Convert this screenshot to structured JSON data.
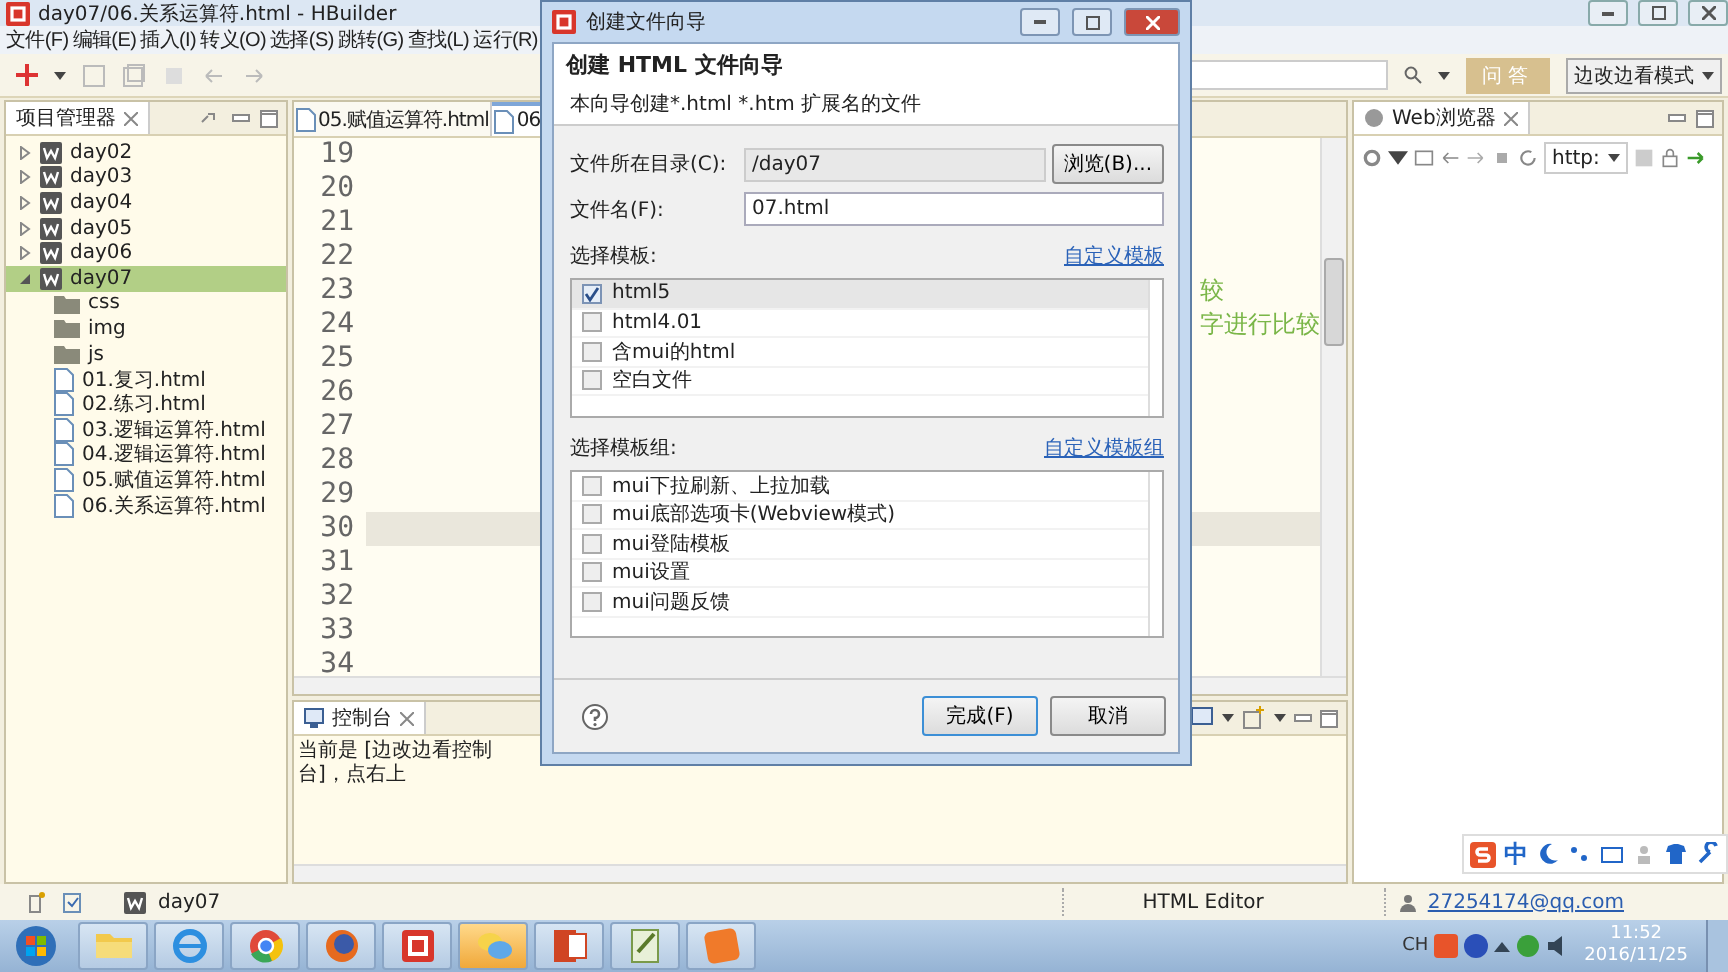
{
  "window": {
    "title": "day07/06.关系运算符.html - HBuilder"
  },
  "menu": [
    "文件(F)",
    "编辑(E)",
    "插入(I)",
    "转义(O)",
    "选择(S)",
    "跳转(G)",
    "查找(L)",
    "运行(R)"
  ],
  "toolbar": {
    "qa_button": "问答",
    "mode_select": "边改边看模式"
  },
  "project_panel": {
    "title": "项目管理器",
    "tree": [
      {
        "label": "day02",
        "kind": "project",
        "expanded": false,
        "selected": false
      },
      {
        "label": "day03",
        "kind": "project",
        "expanded": false,
        "selected": false
      },
      {
        "label": "day04",
        "kind": "project",
        "expanded": false,
        "selected": false
      },
      {
        "label": "day05",
        "kind": "project",
        "expanded": false,
        "selected": false
      },
      {
        "label": "day06",
        "kind": "project",
        "expanded": false,
        "selected": false
      },
      {
        "label": "day07",
        "kind": "project",
        "expanded": true,
        "selected": true,
        "children": [
          {
            "label": "css",
            "kind": "folder",
            "selected": false
          },
          {
            "label": "img",
            "kind": "folder",
            "selected": false
          },
          {
            "label": "js",
            "kind": "folder",
            "selected": false
          },
          {
            "label": "01.复习.html",
            "kind": "file",
            "selected": false
          },
          {
            "label": "02.练习.html",
            "kind": "file",
            "selected": false
          },
          {
            "label": "03.逻辑运算符.html",
            "kind": "file",
            "selected": false
          },
          {
            "label": "04.逻辑运算符.html",
            "kind": "file",
            "selected": false
          },
          {
            "label": "05.赋值运算符.html",
            "kind": "file",
            "selected": false
          },
          {
            "label": "06.关系运算符.html",
            "kind": "file",
            "selected": false
          }
        ]
      }
    ]
  },
  "editor": {
    "tabs": [
      {
        "label": "05.赋值运算符.html",
        "selected": false
      },
      {
        "label": "06",
        "selected": true
      }
    ],
    "lines": [
      {
        "number": "19",
        "current": false
      },
      {
        "number": "20",
        "current": false
      },
      {
        "number": "21",
        "current": false
      },
      {
        "number": "22",
        "current": false
      },
      {
        "number": "23",
        "current": false,
        "text": "较"
      },
      {
        "number": "24",
        "current": false,
        "text": "字进行比较"
      },
      {
        "number": "25",
        "current": false
      },
      {
        "number": "26",
        "current": false
      },
      {
        "number": "27",
        "current": false
      },
      {
        "number": "28",
        "current": false
      },
      {
        "number": "29",
        "current": false
      },
      {
        "number": "30",
        "current": true
      },
      {
        "number": "31",
        "current": false
      },
      {
        "number": "32",
        "current": false
      },
      {
        "number": "33",
        "current": false
      },
      {
        "number": "34",
        "current": false
      }
    ]
  },
  "console": {
    "title": "控制台",
    "message": "当前是 [边改边看控制台]，点右上"
  },
  "browser": {
    "title": "Web浏览器",
    "address": "http:"
  },
  "status_bar": {
    "project": "day07",
    "editor_type": "HTML Editor",
    "account": "27254174@qq.com"
  },
  "ime_bar": {
    "mode": "中"
  },
  "dialog": {
    "title": "创建文件向导",
    "heading": "创建 HTML 文件向导",
    "description": "本向导创建*.html *.htm 扩展名的文件",
    "directory": {
      "label": "文件所在目录(C):",
      "value": "/day07"
    },
    "browse_button": "浏览(B)...",
    "filename": {
      "label": "文件名(F):",
      "value": "07.html"
    },
    "templates": {
      "label": "选择模板:",
      "link": "自定义模板",
      "items": [
        {
          "label": "html5",
          "checked": true,
          "selected": true
        },
        {
          "label": "html4.01",
          "checked": false,
          "selected": false
        },
        {
          "label": "含mui的html",
          "checked": false,
          "selected": false
        },
        {
          "label": "空白文件",
          "checked": false,
          "selected": false
        }
      ]
    },
    "template_groups": {
      "label": "选择模板组:",
      "link": "自定义模板组",
      "items": [
        {
          "label": "mui下拉刷新、上拉加载",
          "checked": false
        },
        {
          "label": "mui底部选项卡(Webview模式)",
          "checked": false
        },
        {
          "label": "mui登陆模板",
          "checked": false
        },
        {
          "label": "mui设置",
          "checked": false
        },
        {
          "label": "mui问题反馈",
          "checked": false
        }
      ]
    },
    "finish_button": "完成(F)",
    "cancel_button": "取消"
  },
  "taskbar": {
    "apps": [
      {
        "kind": "explorer",
        "active": false
      },
      {
        "kind": "ie",
        "active": false
      },
      {
        "kind": "chrome",
        "active": false
      },
      {
        "kind": "firefox",
        "active": false
      },
      {
        "kind": "hbuilder",
        "active": false
      },
      {
        "kind": "chat",
        "active": true
      },
      {
        "kind": "slides",
        "active": false
      },
      {
        "kind": "notepad",
        "active": false
      },
      {
        "kind": "pdf",
        "active": false
      }
    ],
    "language": "CH",
    "time": "11:52",
    "date": "2016/11/25"
  }
}
